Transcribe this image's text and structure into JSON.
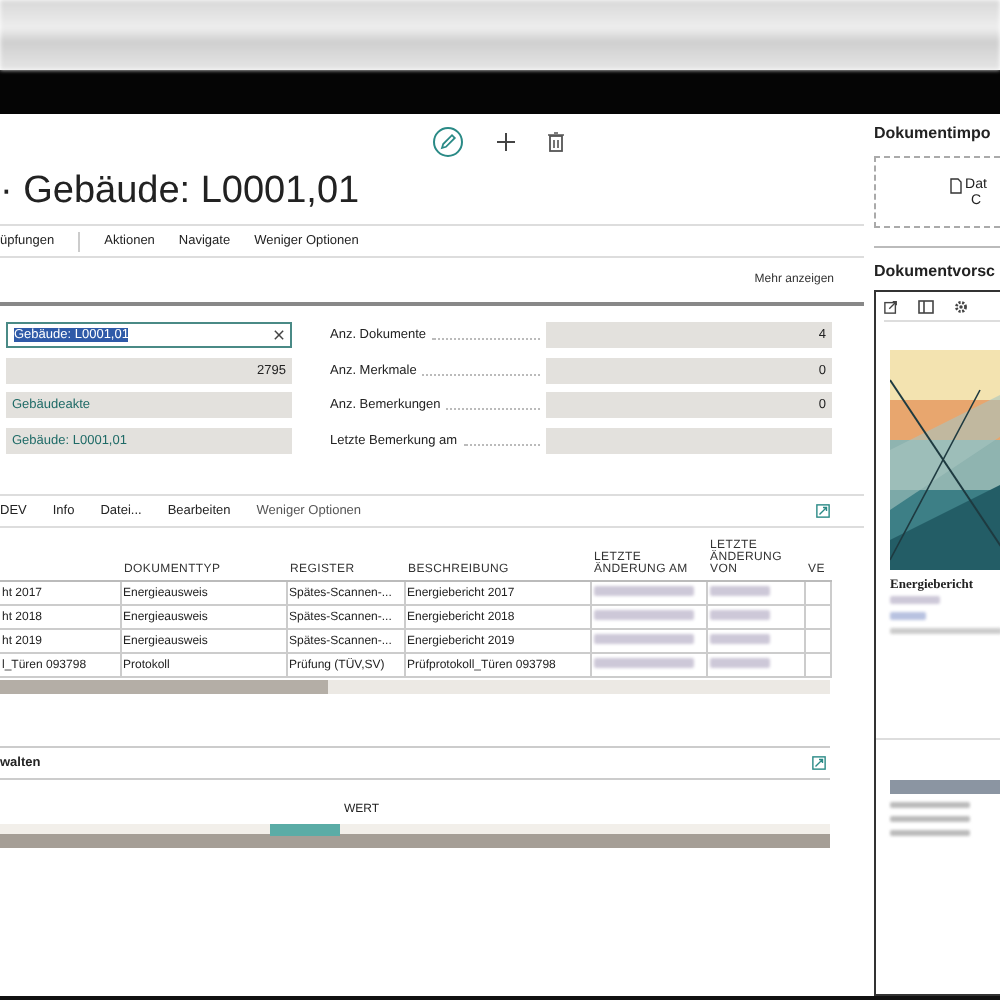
{
  "title": "· Gebäude: L0001,01",
  "action_bar": [
    "üpfungen",
    "Aktionen",
    "Navigate",
    "Weniger Optionen"
  ],
  "show_more": "Mehr anzeigen",
  "left_fields": [
    {
      "kind": "input",
      "value": "Gebäude: L0001,01",
      "selected": true
    },
    {
      "kind": "number",
      "value": "2795"
    },
    {
      "kind": "link",
      "value": "Gebäudeakte"
    },
    {
      "kind": "link",
      "value": "Gebäude: L0001,01"
    }
  ],
  "stats": [
    {
      "label": "Anz. Dokumente",
      "value": "4"
    },
    {
      "label": "Anz. Merkmale",
      "value": "0"
    },
    {
      "label": "Anz. Bemerkungen",
      "value": "0"
    },
    {
      "label": "Letzte Bemerkung am"
    }
  ],
  "documents": {
    "toolbar": [
      "DEV",
      "Info",
      "Datei...",
      "Bearbeiten",
      "Weniger Optionen"
    ],
    "columns": [
      "DOKUMENTTYP",
      "REGISTER",
      "BESCHREIBUNG",
      "LETZTE ÄNDERUNG AM",
      "LETZTE ÄNDERUNG VON",
      "VE"
    ],
    "rows": [
      {
        "column_1": "ht 2017",
        "type": "Energieausweis",
        "register": "Spätes-Scannen-...",
        "description": "Energiebericht 2017"
      },
      {
        "column_1": "ht 2018",
        "type": "Energieausweis",
        "register": "Spätes-Scannen-...",
        "description": "Energiebericht 2018"
      },
      {
        "column_1": "ht 2019",
        "type": "Energieausweis",
        "register": "Spätes-Scannen-...",
        "description": "Energiebericht 2019"
      },
      {
        "column_1": "l_Türen 093798",
        "type": "Protokoll",
        "register": "Prüfung (TÜV,SV)",
        "description": "Prüfprotokoll_Türen 093798"
      }
    ]
  },
  "lower_section": {
    "title": "walten",
    "column_header": "WERT"
  },
  "import": {
    "title": "Dokumentimpo",
    "drop_lines": [
      "Dat",
      "C"
    ]
  },
  "preview": {
    "title": "Dokumentvorsc",
    "doc_title": "Energiebericht"
  }
}
